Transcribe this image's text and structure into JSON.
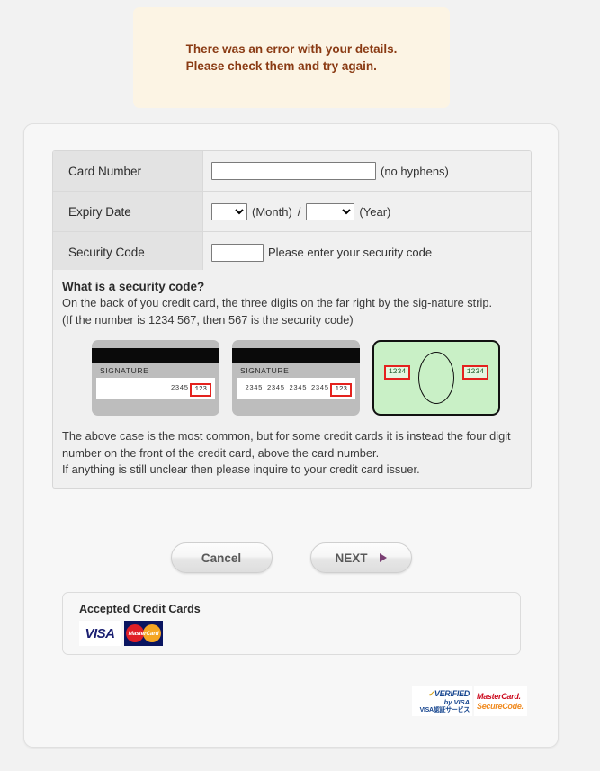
{
  "error": {
    "line1": "There was an error with your details.",
    "line2": "Please check them and try again.",
    "color": "#8a3b14",
    "background": "#fcf4e4"
  },
  "form": {
    "rows": [
      {
        "label": "Card Number",
        "input_value": "",
        "input_placeholder": "",
        "hint": "(no hyphens)"
      },
      {
        "label": "Expiry Date",
        "month_value": "",
        "month_hint": "(Month)",
        "separator": "/",
        "year_value": "",
        "year_hint": "(Year)"
      },
      {
        "label": "Security Code",
        "input_value": "",
        "input_placeholder": "",
        "hint": "Please enter your security code"
      }
    ]
  },
  "info": {
    "heading": "What is a security code?",
    "paragraph1": "On the back of you credit card, the three digits on the far right by the sig-nature strip.",
    "paragraph2": "(If the number is 1234 567, then 567 is the security code)",
    "paragraph3": "The above case is the most common, but for some credit cards it is instead the four digit number on the front of the credit card, above the card number.",
    "paragraph4": "If anything is still unclear then please inquire to your credit card issuer.",
    "cards": [
      {
        "type": "back",
        "signature_label": "SIGNATURE",
        "digits": "2345",
        "cvv": "123"
      },
      {
        "type": "back",
        "signature_label": "SIGNATURE",
        "digits": "2345 2345 2345 2345",
        "cvv": "123"
      },
      {
        "type": "front",
        "left_code": "1234",
        "right_code": "1234"
      }
    ]
  },
  "buttons": {
    "cancel": "Cancel",
    "next": "NEXT"
  },
  "accepted": {
    "title": "Accepted Credit Cards",
    "logos": [
      {
        "name": "VISA"
      },
      {
        "name": "MasterCard"
      }
    ]
  },
  "badges": {
    "verified_by_visa": {
      "line1": "VERIFIED",
      "line2": "by VISA",
      "line3": "VISA認証サービス"
    },
    "securecode": {
      "line1": "MasterCard.",
      "line2": "SecureCode."
    }
  }
}
